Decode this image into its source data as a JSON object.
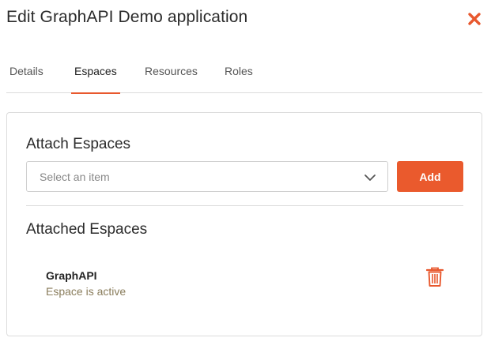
{
  "dialog": {
    "title": "Edit GraphAPI Demo application",
    "close_icon": "close-icon",
    "accent_color": "#ea5a2d"
  },
  "tabs": [
    {
      "label": "Details",
      "active": false
    },
    {
      "label": "Espaces",
      "active": true
    },
    {
      "label": "Resources",
      "active": false
    },
    {
      "label": "Roles",
      "active": false
    }
  ],
  "attach": {
    "title": "Attach Espaces",
    "select_placeholder": "Select an item",
    "add_label": "Add"
  },
  "attached": {
    "title": "Attached Espaces",
    "items": [
      {
        "name": "GraphAPI",
        "status": "Espace is active",
        "action_icon": "trash-icon"
      }
    ]
  }
}
